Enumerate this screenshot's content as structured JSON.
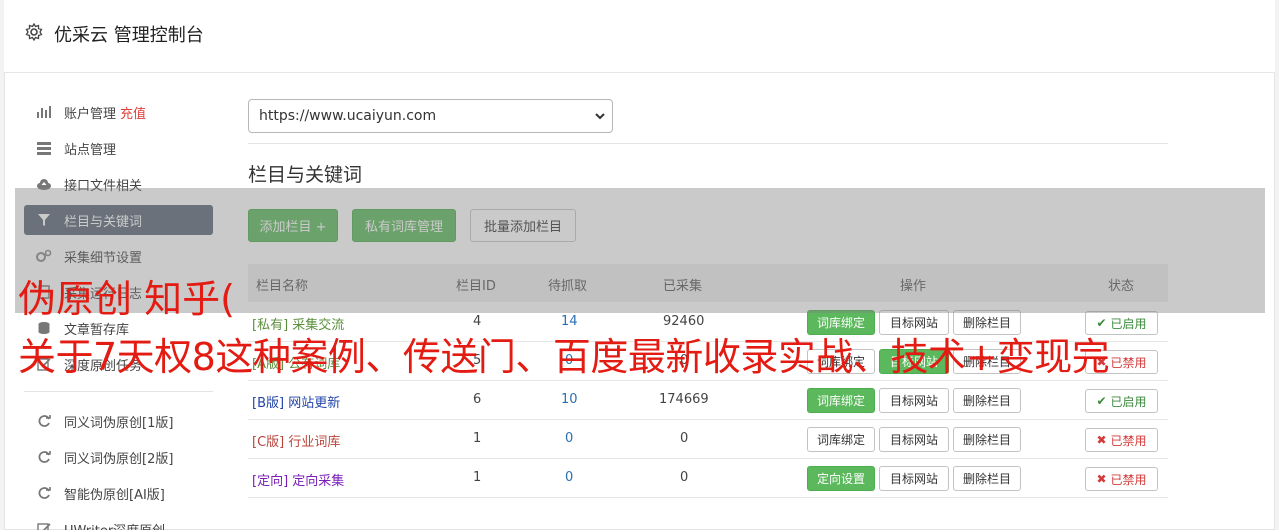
{
  "header": {
    "title": "优采云 管理控制台",
    "icon": "gear-icon"
  },
  "sidebar": {
    "items": [
      {
        "label": "账户管理",
        "extra": "充值",
        "icon": "bar-chart-icon"
      },
      {
        "label": "站点管理",
        "icon": "server-icon"
      },
      {
        "label": "接口文件相关",
        "icon": "cloud-upload-icon"
      },
      {
        "label": "栏目与关键词",
        "icon": "filter-icon",
        "active": true
      },
      {
        "label": "采集细节设置",
        "icon": "gears-icon"
      },
      {
        "label": "采集运行日志",
        "icon": "log-icon"
      },
      {
        "label": "文章暂存库",
        "icon": "database-icon"
      },
      {
        "label": "深度原创任务",
        "icon": "edit-icon"
      },
      {
        "label": "同义词伪原创[1版]",
        "icon": "refresh-icon"
      },
      {
        "label": "同义词伪原创[2版]",
        "icon": "refresh-icon"
      },
      {
        "label": "智能伪原创[AI版]",
        "icon": "refresh-icon"
      },
      {
        "label": "UWriter深度原创",
        "icon": "pencil-icon"
      }
    ]
  },
  "site_select": {
    "value": "https://www.ucaiyun.com"
  },
  "section": {
    "title": "栏目与关键词"
  },
  "toolbar": {
    "add_column": "添加栏目 +",
    "private_lib": "私有词库管理",
    "batch_add": "批量添加栏目"
  },
  "table": {
    "headers": [
      "栏目名称",
      "栏目ID",
      "待抓取",
      "已采集",
      "操作",
      "状态"
    ],
    "rows": [
      {
        "tag": "[私有]",
        "name": "采集交流",
        "id": "4",
        "pending": "14",
        "collected": "92460",
        "bind": "词库绑定",
        "target": "目标网站",
        "delete": "删除栏目",
        "status": "已启用"
      },
      {
        "tag": "[A版]",
        "name": "公有词库",
        "id": "5",
        "pending": "0",
        "collected": "0",
        "bind": "词库绑定",
        "target": "目标网站",
        "delete": "删除栏目",
        "status": "已禁用"
      },
      {
        "tag": "[B版]",
        "name": "网站更新",
        "id": "6",
        "pending": "10",
        "collected": "174669",
        "bind": "词库绑定",
        "target": "目标网站",
        "delete": "删除栏目",
        "status": "已启用"
      },
      {
        "tag": "[C版]",
        "name": "行业词库",
        "id": "1",
        "pending": "0",
        "collected": "0",
        "bind": "词库绑定",
        "target": "目标网站",
        "delete": "删除栏目",
        "status": "已禁用"
      },
      {
        "tag": "[定向]",
        "name": "定向采集",
        "id": "1",
        "pending": "0",
        "collected": "0",
        "bind": "定向设置",
        "target": "目标网站",
        "delete": "删除栏目",
        "status": "已禁用"
      }
    ]
  },
  "watermark": {
    "line1": "伪原创 知乎(",
    "line2": "关于7天权8这种案例、传送门、百度最新收录实战、技术+变现完"
  },
  "colors": {
    "green": "#5cb85c",
    "active_nav": "#5b6775",
    "watermark": "#e31b12",
    "recharge": "#e0403b"
  }
}
